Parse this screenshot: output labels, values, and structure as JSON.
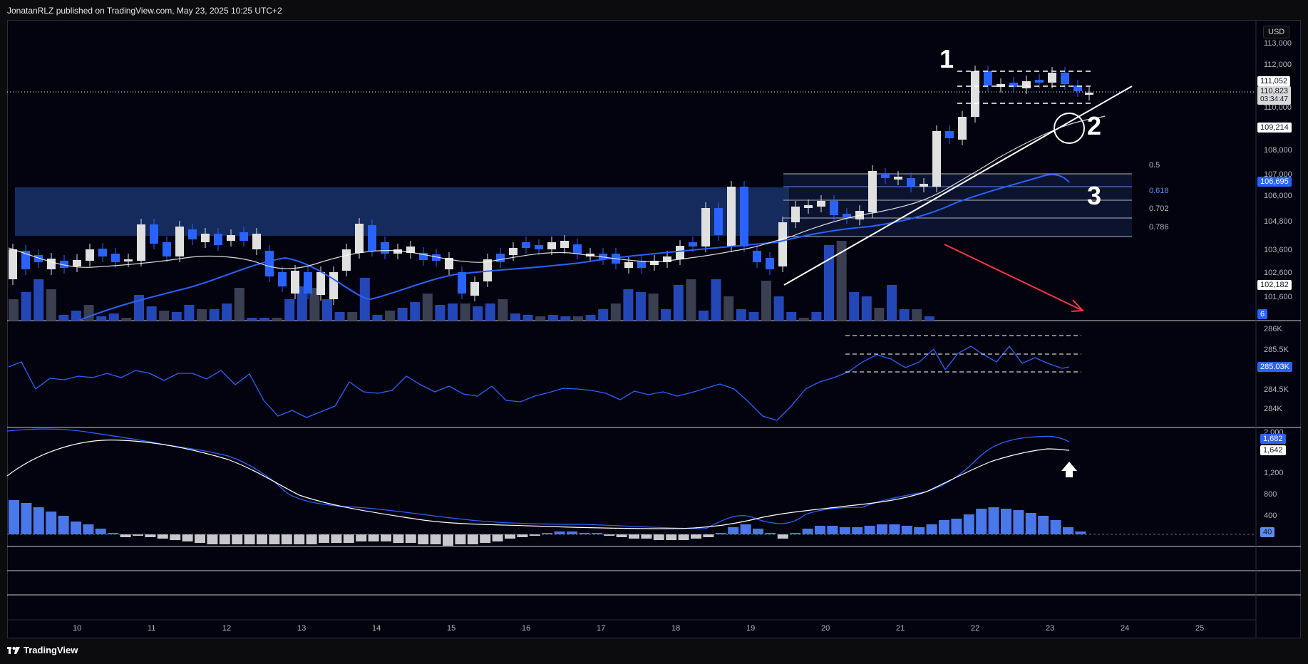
{
  "header": {
    "text": "JonatanRLZ published on TradingView.com, May 23, 2025 10:25 UTC+2"
  },
  "footer": {
    "brand": "TradingView",
    "logo_icon": "tradingview-logo-icon"
  },
  "currency_button": "USD",
  "price_axis": {
    "labels": [
      "113,000",
      "112,000",
      "111,000",
      "110,000",
      "108,000",
      "107,000",
      "106,000",
      "104,800",
      "103,600",
      "102,600",
      "101,600"
    ],
    "tags": {
      "last_price": "111,052",
      "current": "110,823",
      "countdown": "03:34:47",
      "line_value": "109,214",
      "ema_value": "106,695",
      "low_value": "102,182",
      "volume_value": "6"
    }
  },
  "indicator1_axis": {
    "labels": [
      "286K",
      "285.5K",
      "284.5K",
      "284K"
    ],
    "tag": "285.03K"
  },
  "indicator2_axis": {
    "labels": [
      "2,000",
      "1,200",
      "800",
      "400"
    ],
    "tags": {
      "macd": "1,682",
      "signal": "1,642",
      "hist": "40"
    }
  },
  "time_axis": {
    "labels": [
      "10",
      "11",
      "12",
      "13",
      "14",
      "15",
      "16",
      "17",
      "18",
      "19",
      "20",
      "21",
      "22",
      "23",
      "24",
      "25"
    ]
  },
  "fib_levels": [
    {
      "label": "0.5",
      "color": "#b2b5be"
    },
    {
      "label": "0.618",
      "color": "#5b8def"
    },
    {
      "label": "0.702",
      "color": "#b2b5be"
    },
    {
      "label": "0.786",
      "color": "#b2b5be"
    }
  ],
  "annotations": {
    "one": "1",
    "two": "2",
    "three": "3"
  },
  "colors": {
    "bull": "#e0e0e0",
    "bear": "#2962ff",
    "ema": "#2962ff",
    "sma": "#ffffff",
    "zone": "#1c3a7a",
    "arrow_red": "#f23645"
  },
  "chart_data": {
    "type": "candlestick",
    "x": [
      "10",
      "11",
      "12",
      "13",
      "14",
      "15",
      "16",
      "17",
      "18",
      "19",
      "20",
      "21",
      "22",
      "23"
    ],
    "ylim": [
      101600,
      113000
    ],
    "series": [
      {
        "name": "",
        "values": [
          103600,
          104200,
          104800,
          103600,
          104200,
          103300,
          103600,
          103900,
          103600,
          105000,
          104800,
          106900,
          111000,
          110823
        ]
      }
    ]
  }
}
